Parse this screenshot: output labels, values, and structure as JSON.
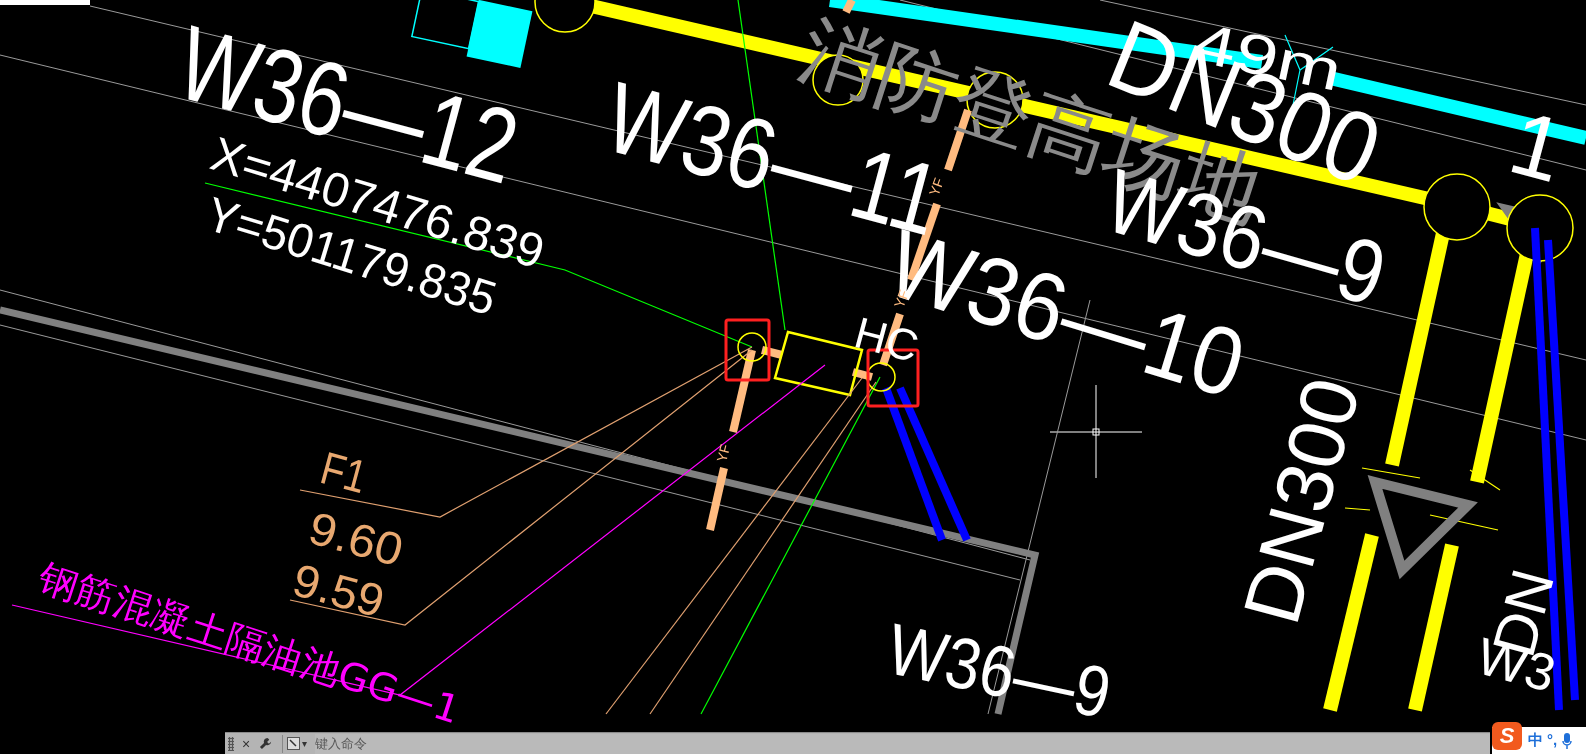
{
  "drawing": {
    "labels": [
      {
        "text": "W36—12",
        "kind": "pipe-id"
      },
      {
        "text": "W36—11",
        "kind": "pipe-id"
      },
      {
        "text": "W36—10",
        "kind": "pipe-id"
      },
      {
        "text": "W36—9",
        "kind": "pipe-id"
      },
      {
        "text": "消防登高场地",
        "kind": "area-name"
      },
      {
        "text": "DN300",
        "kind": "pipe-size"
      },
      {
        "text": "49m",
        "kind": "dimension"
      },
      {
        "text": "1",
        "kind": "pipe-id"
      },
      {
        "text": "X=4407476.839",
        "kind": "coordinate"
      },
      {
        "text": "Y=501179.835",
        "kind": "coordinate"
      },
      {
        "text": "F1",
        "kind": "elevation"
      },
      {
        "text": "9.60",
        "kind": "elevation"
      },
      {
        "text": "9.59",
        "kind": "elevation"
      },
      {
        "text": "钢筋混凝土隔油池GG—1",
        "kind": "structure-name"
      },
      {
        "text": "DN300",
        "kind": "pipe-size"
      },
      {
        "text": "DN",
        "kind": "pipe-size"
      },
      {
        "text": "W3",
        "kind": "pipe-id"
      },
      {
        "text": "W36—9",
        "kind": "pipe-id"
      },
      {
        "text": "HC",
        "kind": "pipe-id"
      },
      {
        "text": "YF",
        "kind": "pipe-code"
      },
      {
        "text": "YF",
        "kind": "pipe-code"
      },
      {
        "text": "YF",
        "kind": "pipe-code"
      }
    ]
  },
  "command_line": {
    "close": "×",
    "history": "▾",
    "placeholder": "键入命令"
  },
  "ime_toolbar": {
    "logo": "S",
    "mode": "中",
    "punctuation": "°,"
  }
}
